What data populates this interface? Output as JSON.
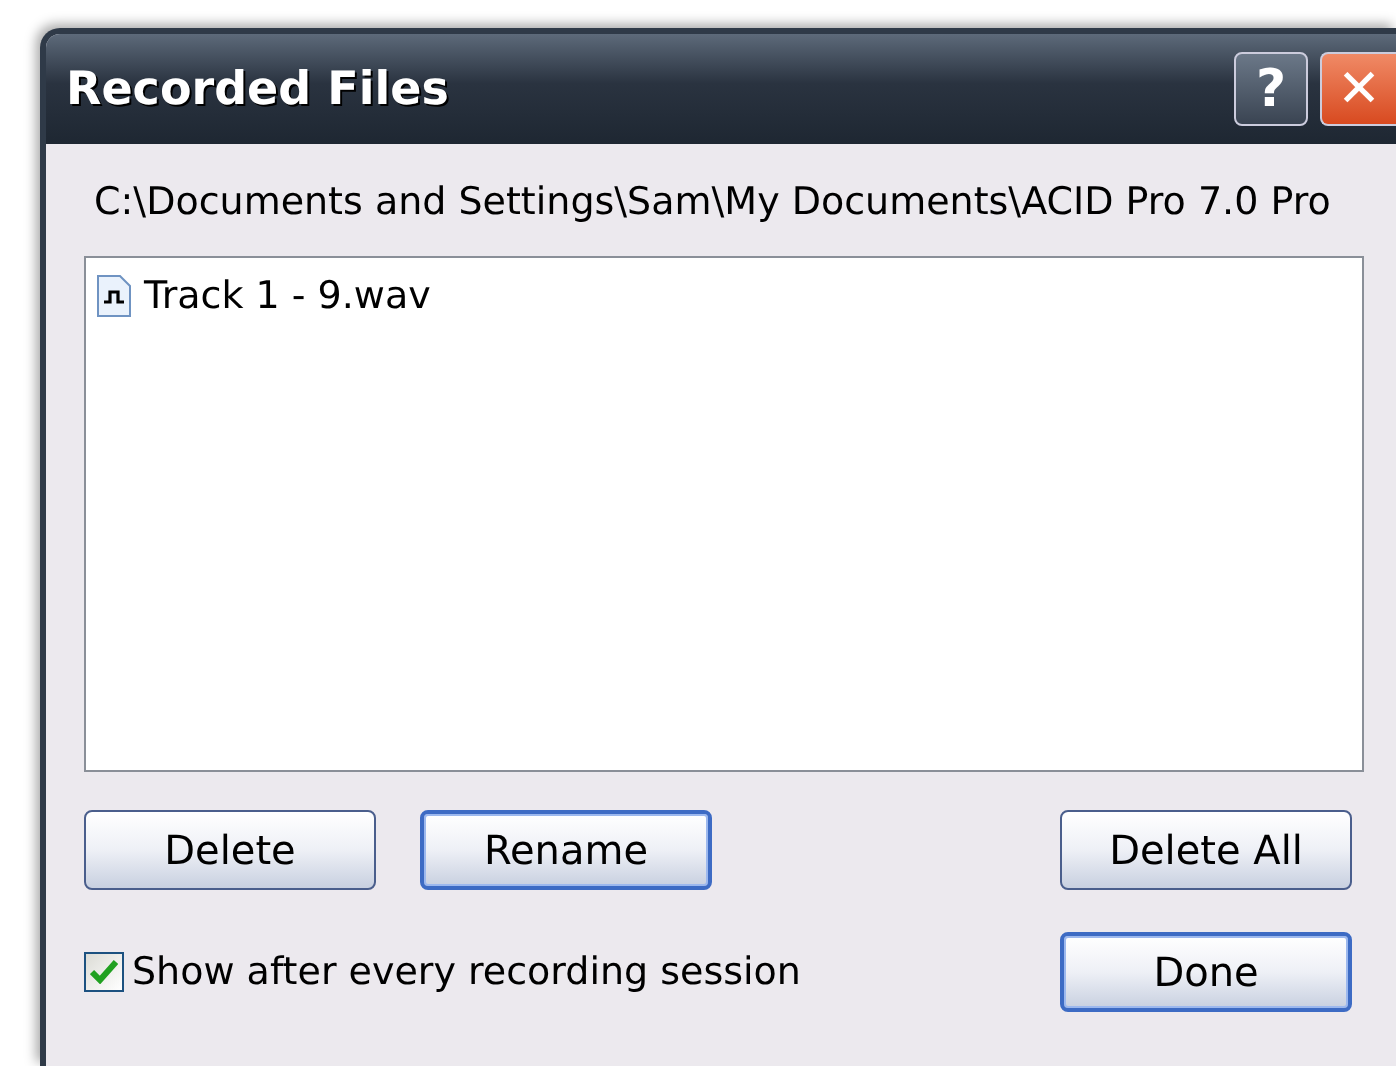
{
  "window": {
    "title": "Recorded Files",
    "title_buttons": [
      {
        "kind": "help",
        "label": "?"
      },
      {
        "kind": "close",
        "label": "✕"
      }
    ]
  },
  "folder_path": "C:\\Documents and Settings\\Sam\\My Documents\\ACID Pro 7.0 Pro",
  "files": [
    {
      "name": "Track 1 - 9.wav",
      "selected": false
    }
  ],
  "buttons": [
    {
      "label": "Delete",
      "default": false
    },
    {
      "label": "Rename",
      "default": true
    },
    {
      "label": "Delete All",
      "default": false
    }
  ],
  "show_after_session": {
    "label": "Show after every recording session",
    "checked": true
  },
  "done_button": {
    "label": "Done",
    "default": true
  }
}
